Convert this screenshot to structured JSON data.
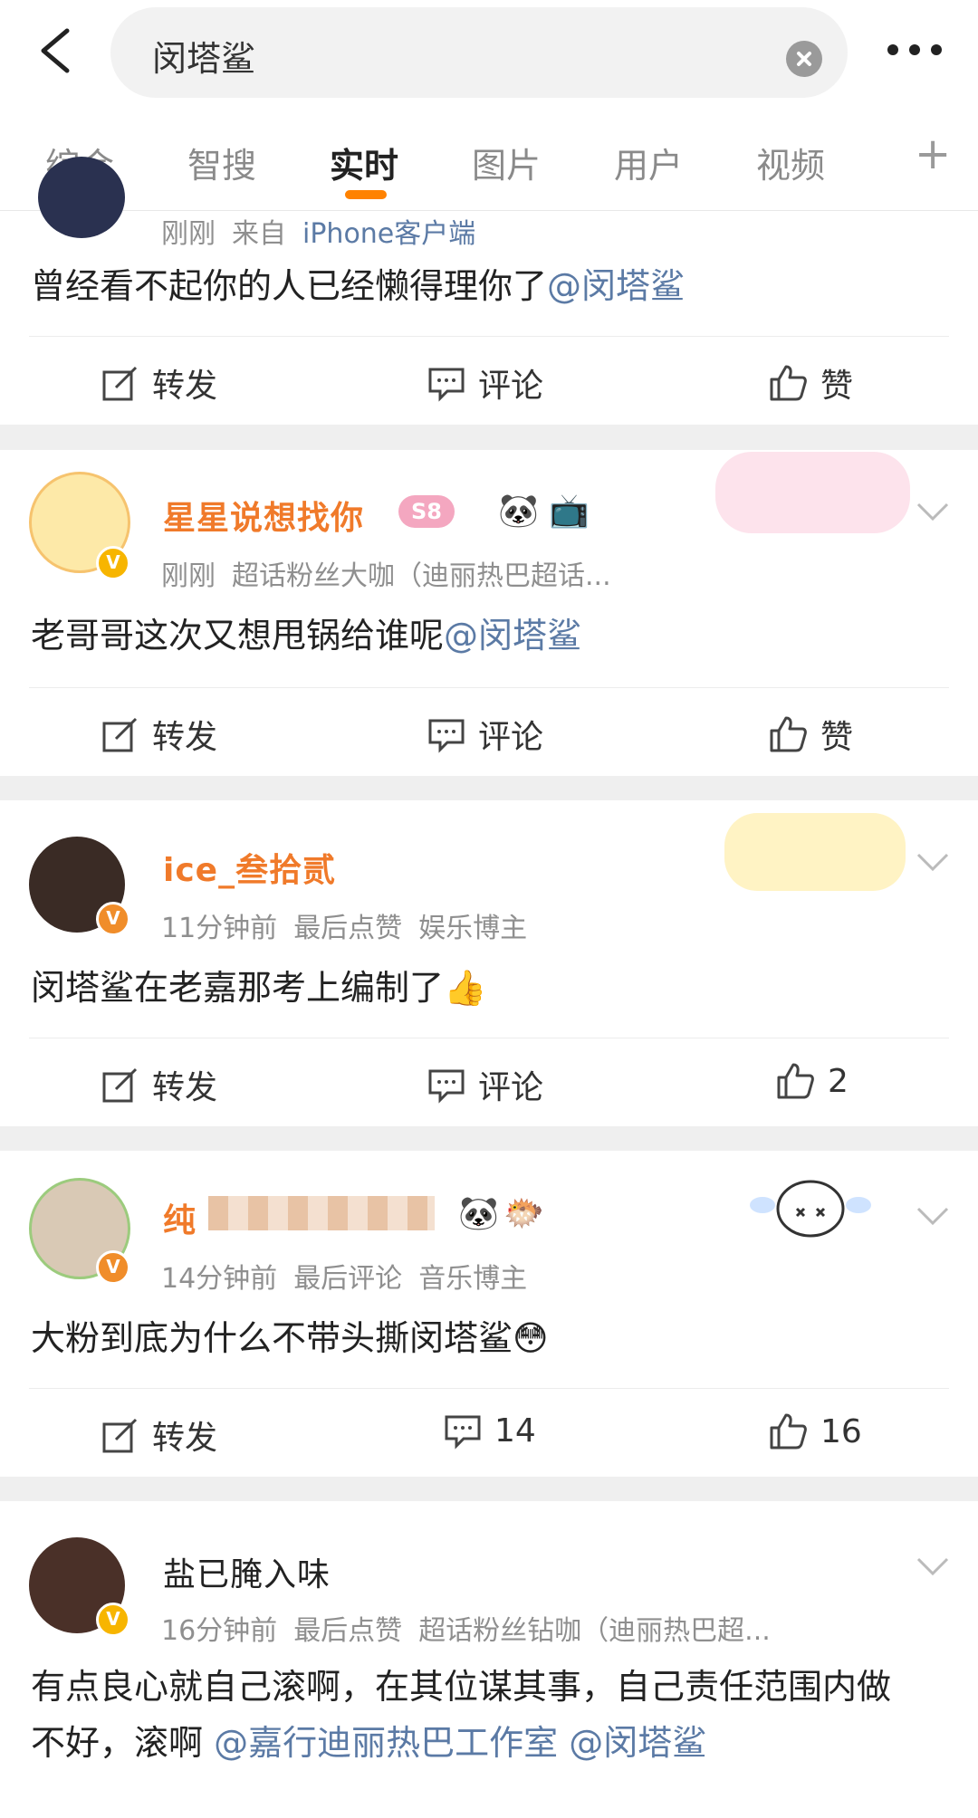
{
  "search": {
    "query": "闵塔鲨"
  },
  "tabs": [
    "综合",
    "智搜",
    "实时",
    "图片",
    "用户",
    "视频"
  ],
  "posts": [
    {
      "name": "",
      "meta": [
        "刚刚",
        "来自",
        "iPhone客户端"
      ],
      "text": "曾经看不起你的人已经懒得理你了",
      "mentions": [
        "@闵塔鲨"
      ],
      "actions": {
        "repost": "转发",
        "comment": "评论",
        "like": "赞"
      }
    },
    {
      "name": "星星说想找你",
      "level": "S8",
      "meta": [
        "刚刚",
        "超话粉丝大咖（迪丽热巴超话..."
      ],
      "text": "老哥哥这次又想甩锅给谁呢",
      "mentions": [
        "@闵塔鲨"
      ],
      "actions": {
        "repost": "转发",
        "comment": "评论",
        "like": "赞"
      }
    },
    {
      "name": "ice_叁拾贰",
      "meta": [
        "11分钟前",
        "最后点赞",
        "娱乐博主"
      ],
      "text": "闵塔鲨在老嘉那考上编制了",
      "emoji": "👍",
      "mentions": [],
      "actions": {
        "repost": "转发",
        "comment": "评论",
        "like": "2"
      }
    },
    {
      "name": "纯",
      "meta": [
        "14分钟前",
        "最后评论",
        "音乐博主"
      ],
      "text": "大粉到底为什么不带头撕闵塔鲨",
      "emoji": "😳",
      "mentions": [],
      "actions": {
        "repost": "转发",
        "comment": "14",
        "like": "16"
      }
    },
    {
      "name": "盐已腌入味",
      "meta": [
        "16分钟前",
        "最后点赞",
        "超话粉丝钻咖（迪丽热巴超..."
      ],
      "text_line1": "有点良心就自己滚啊，在其位谋其事，自己责任范围内做",
      "text_line2": "不好，滚啊",
      "mentions": [
        "@嘉行迪丽热巴工作室",
        "@闵塔鲨"
      ]
    }
  ],
  "colors": {
    "accent": "#ff8200",
    "link": "#5b7aa5",
    "vip_name": "#f07a2a"
  }
}
